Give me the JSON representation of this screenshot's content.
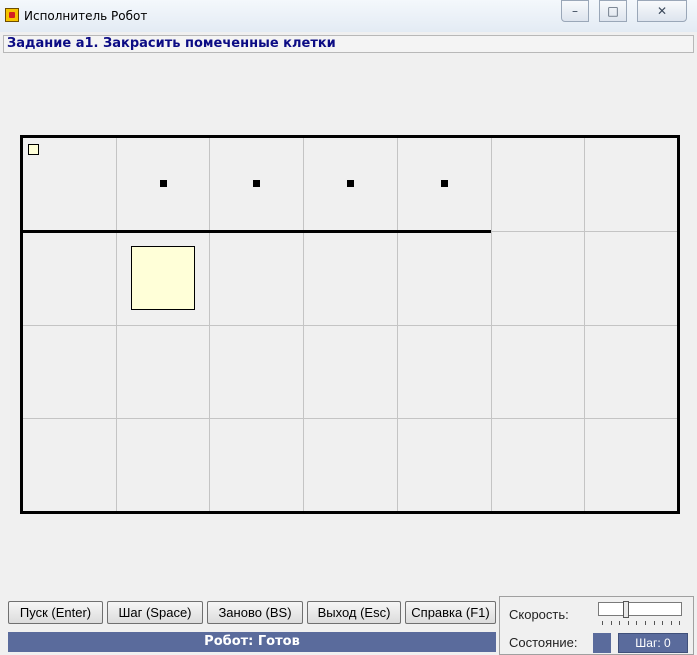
{
  "window": {
    "title": "Исполнитель Робот",
    "icon": "robot-app-icon",
    "controls": [
      "minimize-icon",
      "maximize-icon",
      "close-icon"
    ]
  },
  "task": {
    "title": "Задание а1. Закрасить помеченные клетки"
  },
  "field": {
    "columns": 7,
    "rows": 4,
    "robot_cell": {
      "col": 1,
      "row": 1
    },
    "marked_cells": [
      {
        "col": 2,
        "row": 1
      },
      {
        "col": 3,
        "row": 1
      },
      {
        "col": 4,
        "row": 1
      },
      {
        "col": 5,
        "row": 1
      }
    ],
    "painted_cells": [
      {
        "col": 2,
        "row": 2
      }
    ],
    "walls": [
      {
        "type": "horizontal",
        "below_row": 1,
        "from_col": 1,
        "to_col": 5
      }
    ],
    "colors": {
      "painted": "#ffffd8",
      "grid": "#c4c4c4",
      "wall": "#000000",
      "background": "#f0f0f0"
    }
  },
  "buttons": {
    "run": "Пуск (Enter)",
    "step": "Шаг (Space)",
    "reset": "Заново (BS)",
    "exit": "Выход (Esc)",
    "help": "Справка (F1)"
  },
  "status": {
    "text": "Робот: Готов",
    "speed_label": "Скорость:",
    "state_label": "Состояние:",
    "step_counter": "Шаг: 0",
    "accent_color": "#5a6b9c"
  }
}
